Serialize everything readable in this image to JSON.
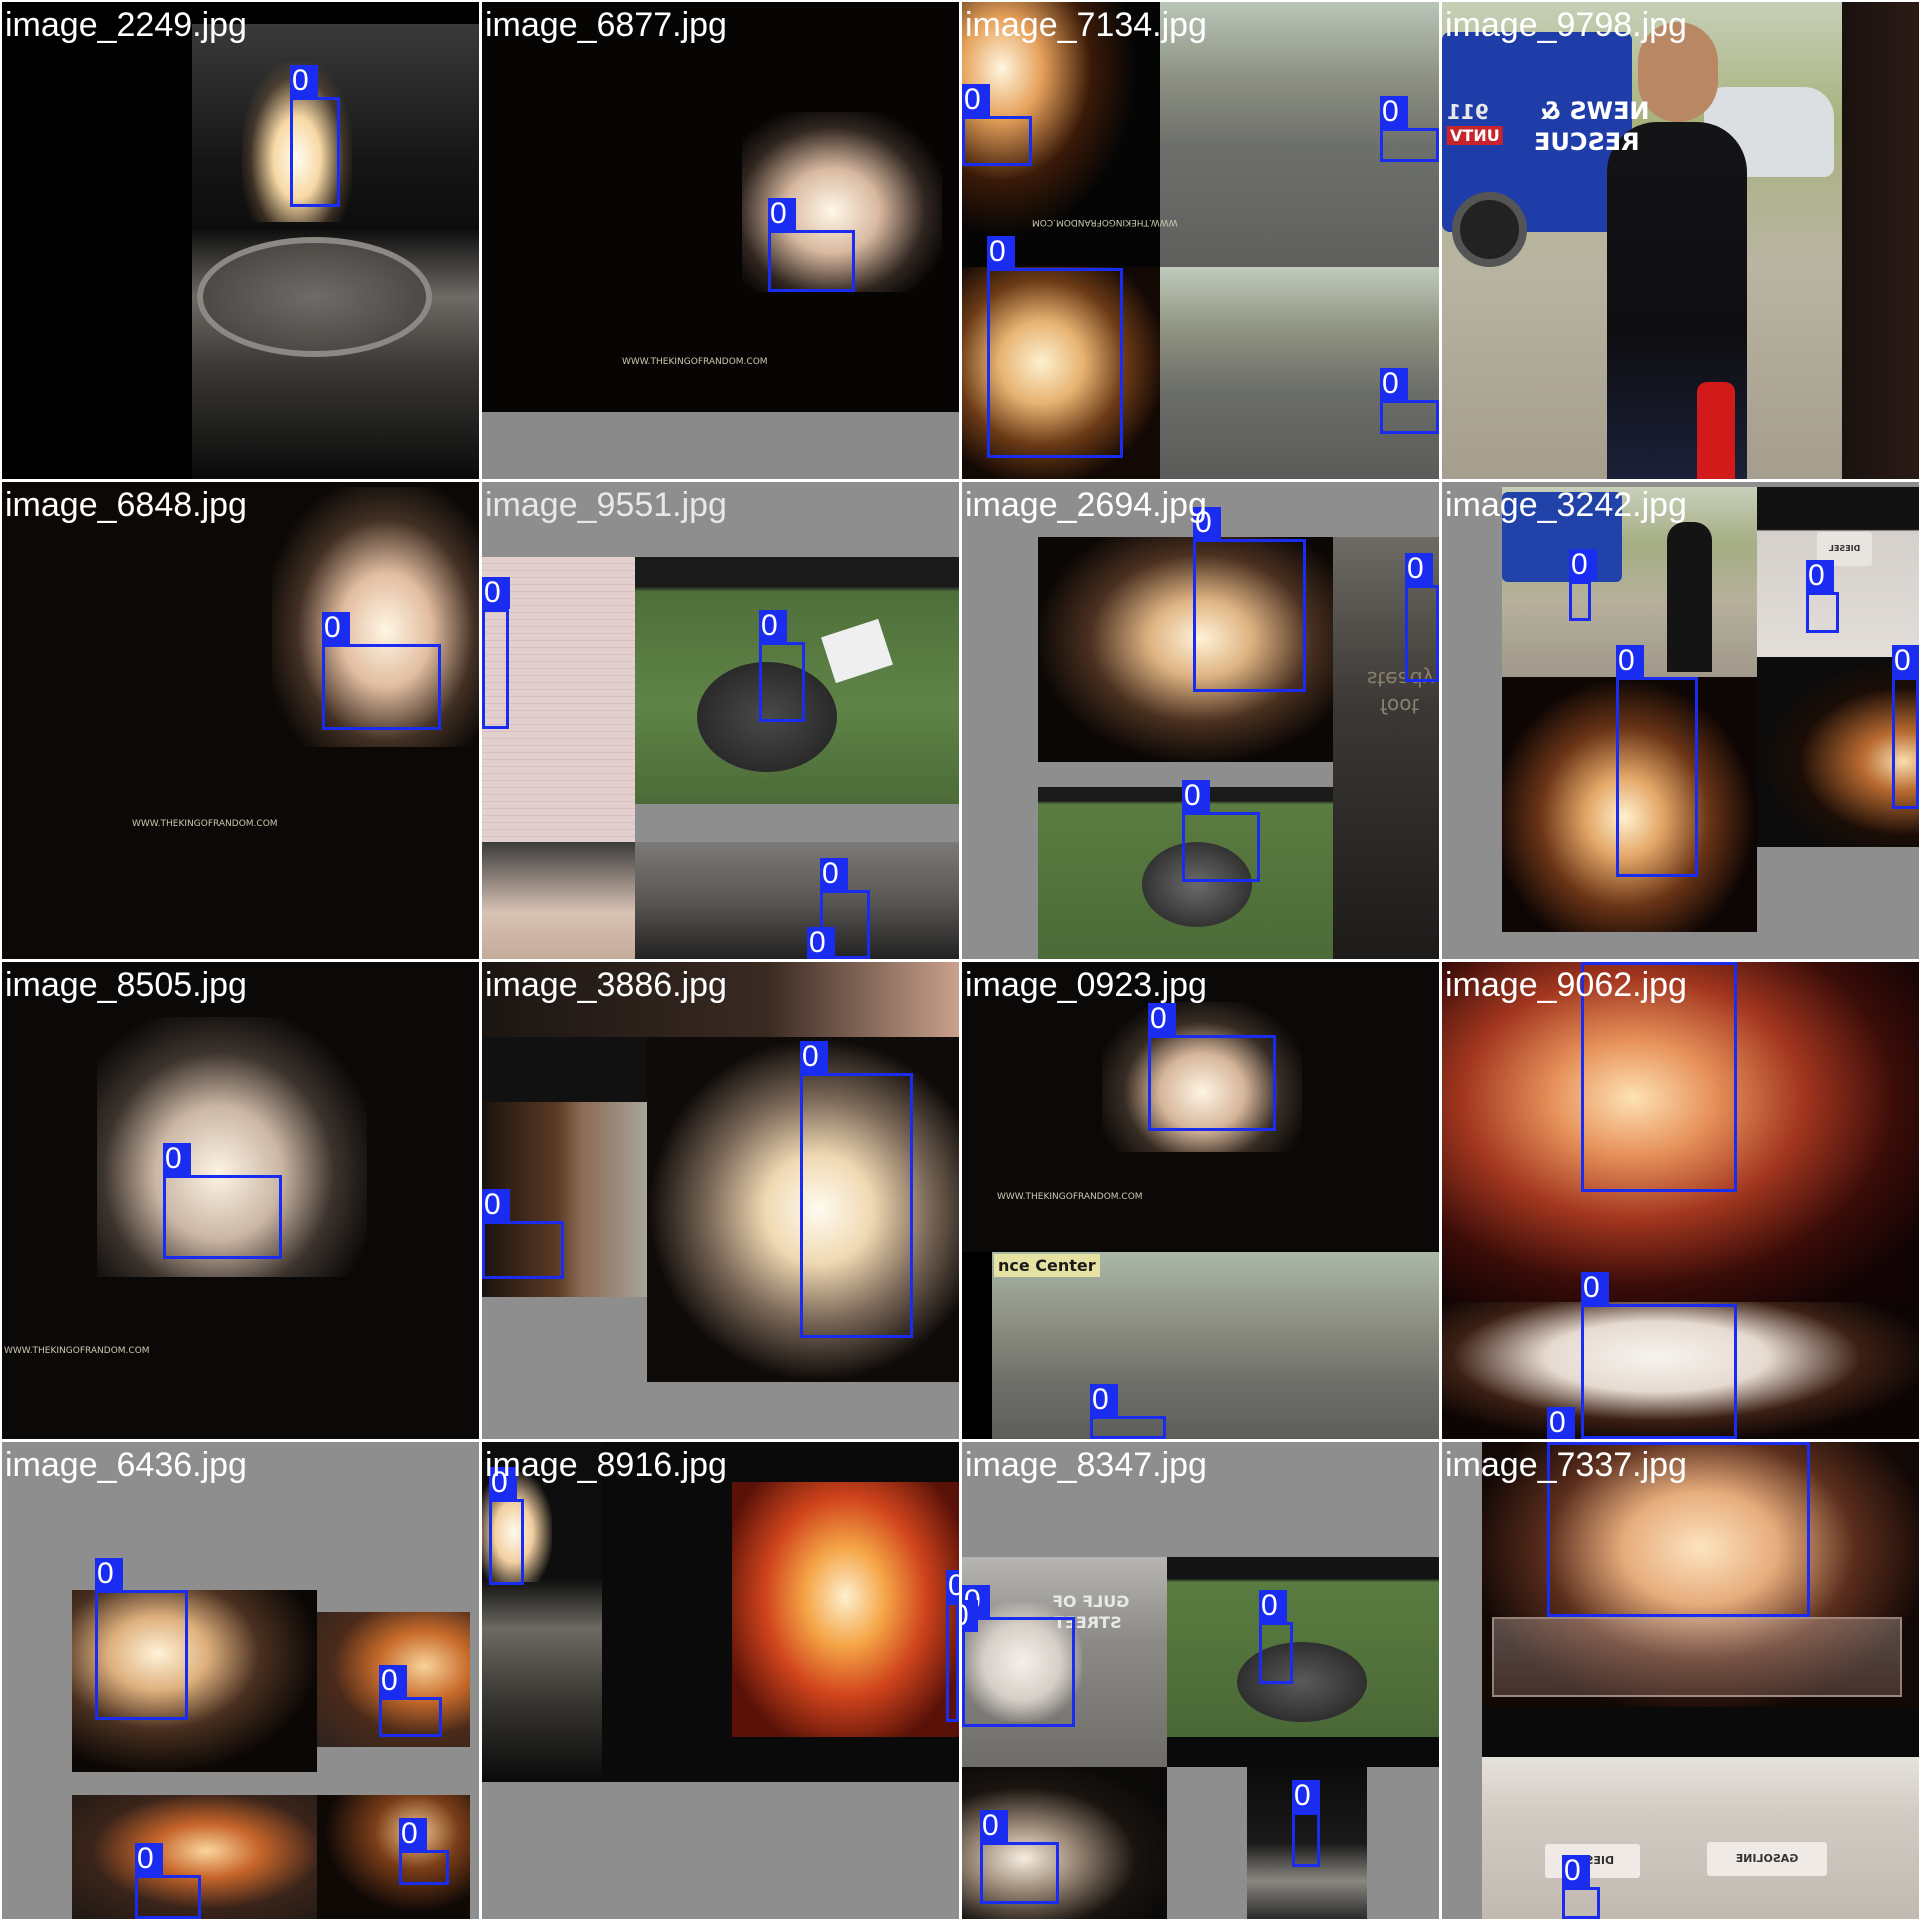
{
  "mosaic": {
    "tiles": [
      {
        "filename": "image_2249.jpg",
        "detections": [
          "0"
        ]
      },
      {
        "filename": "image_6877.jpg",
        "detections": [
          "0"
        ],
        "watermark": "WWW.THEKINGOFRANDOM.COM"
      },
      {
        "filename": "image_7134.jpg",
        "detections": [
          "0",
          "0",
          "0",
          "0"
        ],
        "watermark": "WWW.THEKINGOFRANDOM.COM"
      },
      {
        "filename": "image_9798.jpg",
        "detections": [],
        "sign_lines": [
          "911",
          "UNTV",
          "NEWS &",
          "RESCUE"
        ]
      },
      {
        "filename": "image_6848.jpg",
        "detections": [
          "0"
        ],
        "watermark": "WWW.THEKINGOFRANDOM.COM"
      },
      {
        "filename": "image_9551.jpg",
        "detections": [
          "0",
          "0",
          "0",
          "0"
        ]
      },
      {
        "filename": "image_2694.jpg",
        "detections": [
          "0",
          "0",
          "0"
        ],
        "side_text": [
          "steady",
          "foot"
        ]
      },
      {
        "filename": "image_3242.jpg",
        "detections": [
          "0",
          "0",
          "0",
          "0"
        ],
        "box_label": "DIESEL"
      },
      {
        "filename": "image_8505.jpg",
        "detections": [
          "0"
        ],
        "watermark": "WWW.THEKINGOFRANDOM.COM"
      },
      {
        "filename": "image_3886.jpg",
        "detections": [
          "0",
          "0"
        ]
      },
      {
        "filename": "image_0923.jpg",
        "detections": [
          "0",
          "0"
        ],
        "watermark": "WWW.THEKINGOFRANDOM.COM",
        "sign": "nce Center"
      },
      {
        "filename": "image_9062.jpg",
        "detections": [
          "0",
          "0",
          "0"
        ]
      },
      {
        "filename": "image_6436.jpg",
        "detections": [
          "0",
          "0",
          "0",
          "0"
        ]
      },
      {
        "filename": "image_8916.jpg",
        "detections": [
          "0",
          "0"
        ]
      },
      {
        "filename": "image_8347.jpg",
        "detections": [
          "0",
          "0",
          "0",
          "0",
          "0"
        ],
        "sign_lines": [
          "GULF OF",
          "STREET"
        ]
      },
      {
        "filename": "image_7337.jpg",
        "detections": [
          "0",
          "0"
        ],
        "box_labels": [
          "DIESEL",
          "GASOLINE"
        ]
      }
    ]
  },
  "colors": {
    "bbox": "#1a2cf0",
    "label_text_dark_bg": "#ffffff",
    "label_text_light_bg": "#111111"
  }
}
